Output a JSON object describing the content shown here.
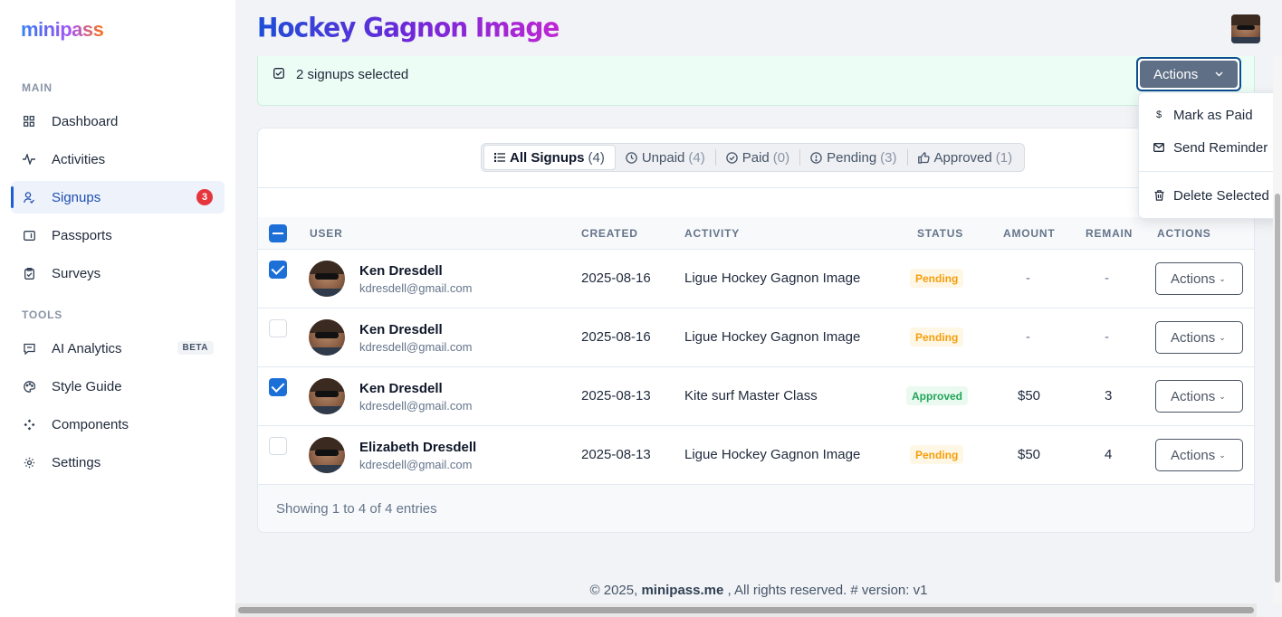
{
  "app": {
    "logo": "minipass"
  },
  "sidebar": {
    "sections": {
      "main": "MAIN",
      "tools": "TOOLS"
    },
    "items": [
      {
        "label": "Dashboard",
        "icon": "grid-icon"
      },
      {
        "label": "Activities",
        "icon": "activity-icon"
      },
      {
        "label": "Signups",
        "icon": "user-icon",
        "badge": "3"
      },
      {
        "label": "Passports",
        "icon": "ticket-icon"
      },
      {
        "label": "Surveys",
        "icon": "clipboard-icon"
      },
      {
        "label": "AI Analytics",
        "icon": "chat-icon",
        "tag": "BETA"
      },
      {
        "label": "Style Guide",
        "icon": "palette-icon"
      },
      {
        "label": "Components",
        "icon": "components-icon"
      },
      {
        "label": "Settings",
        "icon": "gear-icon"
      }
    ]
  },
  "header": {
    "title": "Hockey Gagnon Image"
  },
  "banner": {
    "text": "2 signups selected",
    "actions_label": "Actions"
  },
  "dropdown": {
    "items": [
      {
        "label": "Mark as Paid",
        "icon": "dollar-icon"
      },
      {
        "label": "Send Reminder",
        "icon": "mail-icon"
      },
      {
        "label": "Delete Selected",
        "icon": "trash-icon"
      }
    ]
  },
  "tabs": [
    {
      "label": "All Signups",
      "count": "(4)"
    },
    {
      "label": "Unpaid",
      "count": "(4)"
    },
    {
      "label": "Paid",
      "count": "(0)"
    },
    {
      "label": "Pending",
      "count": "(3)"
    },
    {
      "label": "Approved",
      "count": "(1)"
    }
  ],
  "table": {
    "columns": [
      "USER",
      "CREATED",
      "ACTIVITY",
      "STATUS",
      "AMOUNT",
      "REMAIN",
      "ACTIONS"
    ],
    "rows": [
      {
        "name": "Ken Dresdell",
        "email": "kdresdell@gmail.com",
        "created": "2025-08-16",
        "activity": "Ligue Hockey Gagnon Image",
        "status": "Pending",
        "amount": "-",
        "remain": "-",
        "selected": true,
        "actions": "Actions"
      },
      {
        "name": "Ken Dresdell",
        "email": "kdresdell@gmail.com",
        "created": "2025-08-16",
        "activity": "Ligue Hockey Gagnon Image",
        "status": "Pending",
        "amount": "-",
        "remain": "-",
        "selected": false,
        "actions": "Actions"
      },
      {
        "name": "Ken Dresdell",
        "email": "kdresdell@gmail.com",
        "created": "2025-08-13",
        "activity": "Kite surf Master Class",
        "status": "Approved",
        "amount": "$50",
        "remain": "3",
        "selected": true,
        "actions": "Actions"
      },
      {
        "name": "Elizabeth Dresdell",
        "email": "kdresdell@gmail.com",
        "created": "2025-08-13",
        "activity": "Ligue Hockey Gagnon Image",
        "status": "Pending",
        "amount": "$50",
        "remain": "4",
        "selected": false,
        "actions": "Actions"
      }
    ],
    "footer": "Showing 1 to 4 of 4 entries"
  },
  "footer": {
    "copyright": "© 2025,",
    "brand": "minipass.me",
    "rest": ", All rights reserved. # version: v1"
  }
}
